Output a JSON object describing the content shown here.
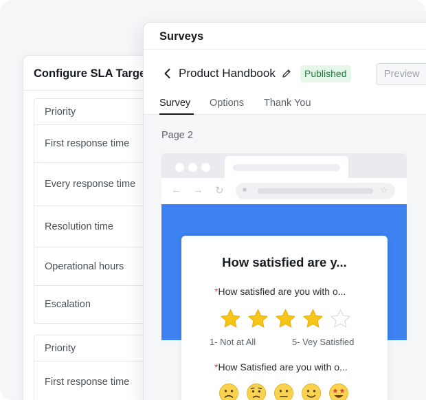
{
  "sla": {
    "title": "Configure SLA Targe",
    "table1": [
      "Priority",
      "First response time",
      "Every response time",
      "Resolution time",
      "Operational hours",
      "Escalation"
    ],
    "table2": [
      "Priority",
      "First response time"
    ]
  },
  "surveys": {
    "window_title": "Surveys",
    "doc_title": "Product Handbook",
    "status_badge": "Published",
    "preview_label": "Preview",
    "tabs": [
      "Survey",
      "Options",
      "Thank You"
    ],
    "active_tab": "Survey",
    "page_label": "Page 2",
    "card": {
      "heading": "How satisfied are y...",
      "required_mark": "*",
      "question1": "How satisfied are you with o...",
      "rating_value": 4,
      "rating_max": 5,
      "scale_min_label": "1- Not at All",
      "scale_max_label": "5- Vey Satisfied",
      "question2": "How Satisfied are you with o...",
      "emoji_options": [
        "frowning-face",
        "worried-face",
        "neutral-face",
        "slightly-smiling-face",
        "star-struck-face"
      ]
    }
  },
  "colors": {
    "accent_blue": "#3d82f0",
    "star_filled": "#f5c518",
    "star_empty": "#e9ebee",
    "badge_bg": "#e6f6ea",
    "badge_text": "#1f7a3c",
    "required": "#e0463c",
    "emoji_yellow": "#f9d34f"
  }
}
